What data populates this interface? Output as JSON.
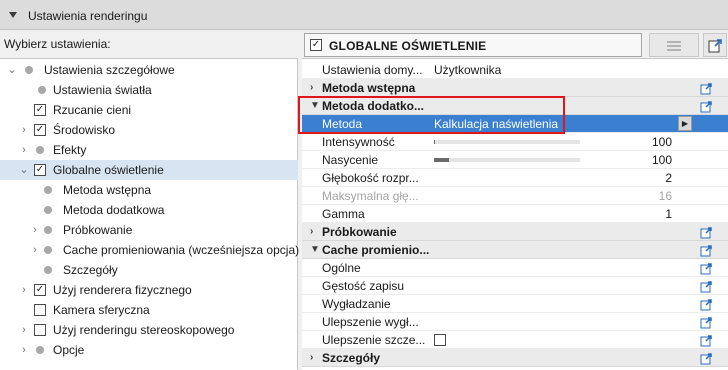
{
  "header": {
    "title": "Ustawienia renderingu"
  },
  "choose_label": "Wybierz ustawienia:",
  "preset": {
    "title": "GLOBALNE OŚWIETLENIE",
    "checked": "✓"
  },
  "tree": {
    "items": [
      {
        "label": "Ustawienia szczegółowe",
        "checked": ""
      },
      {
        "label": "Ustawienia światła",
        "checked": ""
      },
      {
        "label": "Rzucanie cieni",
        "checked": "✓"
      },
      {
        "label": "Środowisko",
        "checked": "✓"
      },
      {
        "label": "Efekty",
        "checked": ""
      },
      {
        "label": "Globalne oświetlenie",
        "checked": "✓"
      },
      {
        "label": "Metoda wstępna",
        "checked": ""
      },
      {
        "label": "Metoda dodatkowa",
        "checked": ""
      },
      {
        "label": "Próbkowanie",
        "checked": ""
      },
      {
        "label": "Cache promieniowania (wcześniejsza opcja)",
        "checked": ""
      },
      {
        "label": "Szczegóły",
        "checked": ""
      },
      {
        "label": "Użyj renderera fizycznego",
        "checked": "✓"
      },
      {
        "label": "Kamera sferyczna",
        "checked": ""
      },
      {
        "label": "Użyj renderingu stereoskopowego",
        "checked": ""
      },
      {
        "label": "Opcje",
        "checked": ""
      }
    ]
  },
  "props": {
    "rows": [
      {
        "name": "Ustawienia domy...",
        "value": "Użytkownika"
      },
      {
        "name": "Metoda wstępna"
      },
      {
        "name": "Metoda dodatko..."
      },
      {
        "name": "Metoda",
        "value": "Kalkulacja naświetlenia"
      },
      {
        "name": "Intensywność",
        "value": "100",
        "level": 0.01
      },
      {
        "name": "Nasycenie",
        "value": "100",
        "level": 0.1
      },
      {
        "name": "Głębokość rozpr...",
        "value": "2"
      },
      {
        "name": "Maksymalna głę...",
        "value": "16"
      },
      {
        "name": "Gamma",
        "value": "1"
      },
      {
        "name": "Próbkowanie"
      },
      {
        "name": "Cache promienio..."
      },
      {
        "name": "Ogólne"
      },
      {
        "name": "Gęstość zapisu"
      },
      {
        "name": "Wygładzanie"
      },
      {
        "name": "Ulepszenie wygł..."
      },
      {
        "name": "Ulepszenie szcze..."
      },
      {
        "name": "Szczegóły"
      }
    ]
  },
  "colors": {
    "highlight": "#3a7fd0",
    "annotation_box": "#e0161c",
    "export_icon": "#2a6cc0"
  },
  "icons": {
    "section_export": "export-preset-icon",
    "dropdown_arrow": "chevron-right-icon"
  }
}
